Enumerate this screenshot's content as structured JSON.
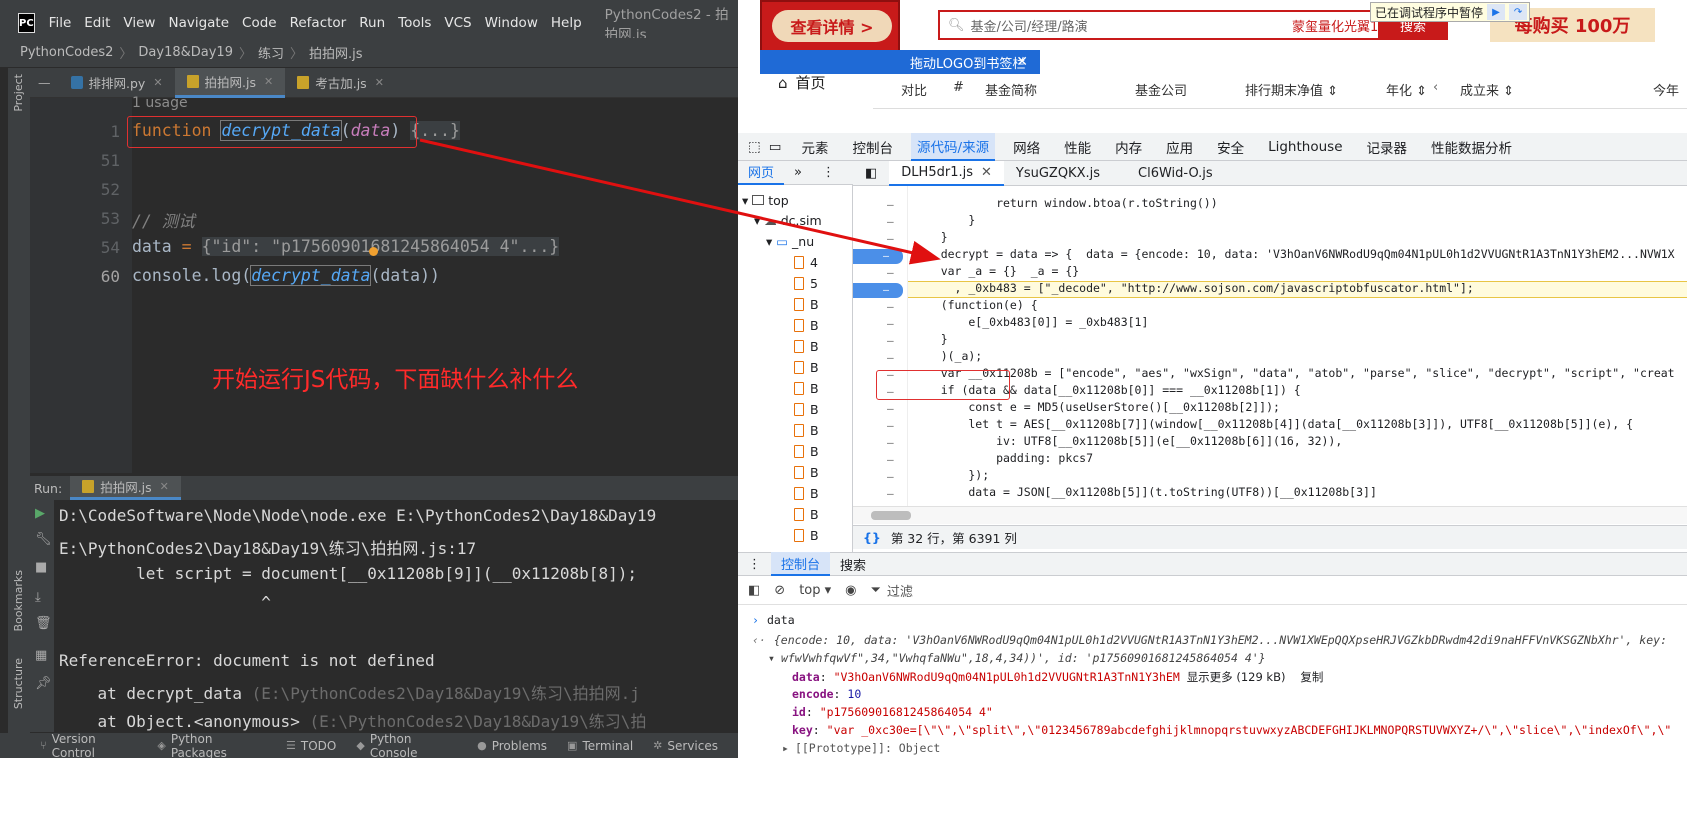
{
  "ide": {
    "menu": [
      "File",
      "Edit",
      "View",
      "Navigate",
      "Code",
      "Refactor",
      "Run",
      "Tools",
      "VCS",
      "Window",
      "Help"
    ],
    "title": "PythonCodes2 - 拍拍网.js",
    "breadcrumb": [
      "PythonCodes2",
      "Day18&Day19",
      "练习",
      "拍拍网.js"
    ],
    "project_label": "Project",
    "tabs": [
      {
        "label": "排排网.py",
        "type": "py"
      },
      {
        "label": "拍拍网.js",
        "type": "js",
        "active": true
      },
      {
        "label": "考古加.js",
        "type": "js"
      }
    ],
    "usage": "1 usage",
    "line_numbers": [
      "1",
      "51",
      "52",
      "53",
      "54",
      "60"
    ],
    "code": {
      "kw_function": "function",
      "fn_name": "decrypt_data",
      "param": "data",
      "folded": "{...}",
      "comment": "// 测试",
      "data_var": "data",
      "eq": " = ",
      "data_value": "{\"id\": \"p17560901681245864054 4\"...}",
      "console": "console",
      "log": ".log(",
      "call": "decrypt_data",
      "arg": "(data))"
    },
    "annotation": "开始运行JS代码，下面缺什么补什么",
    "run_label": "Run:",
    "run_tab": "拍拍网.js",
    "console_lines": [
      "D:\\CodeSoftware\\Node\\Node\\node.exe E:\\PythonCodes2\\Day18&Day19",
      "E:\\PythonCodes2\\Day18&Day19\\练习\\拍拍网.js:17",
      "        let script = document[__0x11208b[9]](__0x11208b[8]);",
      "                     ^",
      "",
      "ReferenceError: document is not defined",
      "    at decrypt_data ",
      "    at Object.<anonymous> "
    ],
    "console_paths": [
      "(E:\\PythonCodes2\\Day18&Day19\\练习\\拍拍网.j",
      "(E:\\PythonCodes2\\Day18&Day19\\练习\\拍"
    ],
    "side_labels": [
      "Bookmarks",
      "Structure"
    ],
    "status_items": [
      "Version Control",
      "Python Packages",
      "TODO",
      "Python Console",
      "Problems",
      "Terminal",
      "Services"
    ]
  },
  "browser": {
    "ad_button": "查看详情 >",
    "search_placeholder": "基金/公司/经理/路演",
    "search_hint": "蒙玺量化光翼1号",
    "search_button": "搜索",
    "promo": "每购买 100万",
    "paused": "已在调试程序中暂停",
    "drag_bar": "拖动LOGO到书签栏",
    "home": "首页",
    "table_headers": [
      "对比",
      "#",
      "基金简称",
      "基金公司",
      "排行期末净值 ⇕",
      "年化 ⇕",
      "成立来 ⇕",
      "今年"
    ]
  },
  "devtools": {
    "tabs": [
      "元素",
      "控制台",
      "源代码/来源",
      "网络",
      "性能",
      "内存",
      "应用",
      "安全",
      "Lighthouse",
      "记录器",
      "性能数据分析"
    ],
    "active_tab": "源代码/来源",
    "nav_tabs": [
      "网页",
      "»"
    ],
    "tree": [
      "top",
      "dc.sim",
      "_nu",
      "4",
      "5",
      "B",
      "B",
      "B",
      "B",
      "B",
      "B",
      "B",
      "B",
      "B",
      "B",
      "B",
      "B"
    ],
    "source_tabs": [
      "DLH5dr1.js",
      "YsuGZQKX.js",
      "Cl6Wid-O.js"
    ],
    "source_lines": [
      "            return window.btoa(r.toString())",
      "        }",
      "    }",
      "  , decrypt = data => {  data = {encode: 10, data: 'V3hOanV6NWRodU9qQm04N1pUL0h1d2VVUGNtR1A3TnN1Y3hEM2...NVW1X",
      "    var _a = {}  _a = {}",
      "      , _0xb483 = [\"_decode\", \"http://www.sojson.com/javascriptobfuscator.html\"];",
      "    (function(e) {",
      "        e[_0xb483[0]] = _0xb483[1]",
      "    }",
      "    )(_a);",
      "    var __0x11208b = [\"encode\", \"aes\", \"wxSign\", \"data\", \"atob\", \"parse\", \"slice\", \"decrypt\", \"script\", \"creat",
      "    if (data && data[__0x11208b[0]] === __0x11208b[1]) {",
      "        const e = MD5(useUserStore()[__0x11208b[2]]);",
      "        let t = AES[__0x11208b[7]](window[__0x11208b[4]](data[__0x11208b[3]]), UTF8[__0x11208b[5]](e), {",
      "            iv: UTF8[__0x11208b[5]](e[__0x11208b[6]](16, 32)),",
      "            padding: pkcs7",
      "        });",
      "        data = JSON[__0x11208b[5]](t.toString(UTF8))[__0x11208b[3]]"
    ],
    "cursor_status": "第 32 行，第 6391 列",
    "console_tabs": [
      "控制台",
      "搜索"
    ],
    "console_context": "top ▾",
    "filter": "过滤",
    "console_input": "data",
    "console_obj_line1": "{encode: 10, data: 'V3hOanV6NWRodU9qQm04N1pUL0h1d2VVUGNtR1A3TnN1Y3hEM2...NVW1XWEpQQXpseHRJVGZkbDRwdm42di9naHFFVnVKSGZNbXhr', key:",
    "console_obj_line2": "wfwVwhfqwVf\",34,\"VwhqfaNWu\",18,4,34))', id: 'p17560901681245864054 4'}",
    "props": [
      {
        "k": "data",
        "v": "\"V3hOanV6NWRodU9qQm04N1pUL0h1d2VVUGNtR1A3TnN1Y3hEM",
        "more": "显示更多 (129 kB)",
        "copy": "复制"
      },
      {
        "k": "encode",
        "v": "10"
      },
      {
        "k": "id",
        "v": "\"p17560901681245864054 4\""
      },
      {
        "k": "key",
        "v": "\"var _0xc30e=[\\\"\\\",\\\"split\\\",\\\"0123456789abcdefghijklmnopqrstuvwxyzABCDEFGHIJKLMNOPQRSTUVWXYZ+/\\\",\\\"slice\\\",\\\"indexOf\\\",\\\""
      }
    ],
    "prototype": "[[Prototype]]: Object"
  }
}
